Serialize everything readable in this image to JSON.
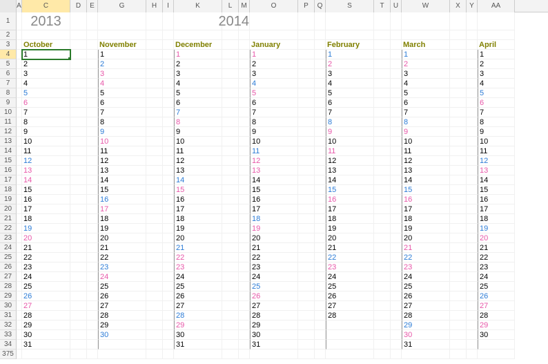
{
  "colHeaders": [
    {
      "label": "A",
      "w": 8,
      "active": false
    },
    {
      "label": "C",
      "w": 70,
      "active": true
    },
    {
      "label": "D",
      "w": 24,
      "active": false
    },
    {
      "label": "E",
      "w": 16,
      "active": false
    },
    {
      "label": "G",
      "w": 70,
      "active": false
    },
    {
      "label": "H",
      "w": 24,
      "active": false
    },
    {
      "label": "I",
      "w": 16,
      "active": false
    },
    {
      "label": "K",
      "w": 70,
      "active": false
    },
    {
      "label": "L",
      "w": 24,
      "active": false
    },
    {
      "label": "M",
      "w": 16,
      "active": false
    },
    {
      "label": "O",
      "w": 70,
      "active": false
    },
    {
      "label": "P",
      "w": 24,
      "active": false
    },
    {
      "label": "Q",
      "w": 16,
      "active": false
    },
    {
      "label": "S",
      "w": 70,
      "active": false
    },
    {
      "label": "T",
      "w": 24,
      "active": false
    },
    {
      "label": "U",
      "w": 16,
      "active": false
    },
    {
      "label": "W",
      "w": 70,
      "active": false
    },
    {
      "label": "X",
      "w": 24,
      "active": false
    },
    {
      "label": "Y",
      "w": 16,
      "active": false
    },
    {
      "label": "AA",
      "w": 54,
      "active": false
    }
  ],
  "rowHeaders": [
    "1",
    "2",
    "3",
    "4",
    "5",
    "6",
    "7",
    "8",
    "9",
    "10",
    "11",
    "12",
    "13",
    "14",
    "15",
    "16",
    "17",
    "18",
    "19",
    "20",
    "21",
    "22",
    "23",
    "24",
    "25",
    "26",
    "27",
    "28",
    "29",
    "30",
    "31",
    "32",
    "33",
    "34",
    "375"
  ],
  "yearLeft": "2013",
  "yearRight": "2014",
  "selectedRow": 4,
  "months": [
    {
      "name": "October",
      "border": false,
      "days": [
        {
          "n": "1",
          "c": "black"
        },
        {
          "n": "2",
          "c": "black"
        },
        {
          "n": "3",
          "c": "black"
        },
        {
          "n": "4",
          "c": "black"
        },
        {
          "n": "5",
          "c": "blue"
        },
        {
          "n": "6",
          "c": "pink"
        },
        {
          "n": "7",
          "c": "black"
        },
        {
          "n": "8",
          "c": "black"
        },
        {
          "n": "9",
          "c": "black"
        },
        {
          "n": "10",
          "c": "black"
        },
        {
          "n": "11",
          "c": "black"
        },
        {
          "n": "12",
          "c": "blue"
        },
        {
          "n": "13",
          "c": "pink"
        },
        {
          "n": "14",
          "c": "pink"
        },
        {
          "n": "15",
          "c": "black"
        },
        {
          "n": "16",
          "c": "black"
        },
        {
          "n": "17",
          "c": "black"
        },
        {
          "n": "18",
          "c": "black"
        },
        {
          "n": "19",
          "c": "blue"
        },
        {
          "n": "20",
          "c": "pink"
        },
        {
          "n": "21",
          "c": "black"
        },
        {
          "n": "22",
          "c": "black"
        },
        {
          "n": "23",
          "c": "black"
        },
        {
          "n": "24",
          "c": "black"
        },
        {
          "n": "25",
          "c": "black"
        },
        {
          "n": "26",
          "c": "blue"
        },
        {
          "n": "27",
          "c": "pink"
        },
        {
          "n": "28",
          "c": "black"
        },
        {
          "n": "29",
          "c": "black"
        },
        {
          "n": "30",
          "c": "black"
        },
        {
          "n": "31",
          "c": "black"
        }
      ]
    },
    {
      "name": "November",
      "border": true,
      "days": [
        {
          "n": "1",
          "c": "black"
        },
        {
          "n": "2",
          "c": "blue"
        },
        {
          "n": "3",
          "c": "pink"
        },
        {
          "n": "4",
          "c": "pink"
        },
        {
          "n": "5",
          "c": "black"
        },
        {
          "n": "6",
          "c": "black"
        },
        {
          "n": "7",
          "c": "black"
        },
        {
          "n": "8",
          "c": "black"
        },
        {
          "n": "9",
          "c": "blue"
        },
        {
          "n": "10",
          "c": "pink"
        },
        {
          "n": "11",
          "c": "black"
        },
        {
          "n": "12",
          "c": "black"
        },
        {
          "n": "13",
          "c": "black"
        },
        {
          "n": "14",
          "c": "black"
        },
        {
          "n": "15",
          "c": "black"
        },
        {
          "n": "16",
          "c": "blue"
        },
        {
          "n": "17",
          "c": "pink"
        },
        {
          "n": "18",
          "c": "black"
        },
        {
          "n": "19",
          "c": "black"
        },
        {
          "n": "20",
          "c": "black"
        },
        {
          "n": "21",
          "c": "black"
        },
        {
          "n": "22",
          "c": "black"
        },
        {
          "n": "23",
          "c": "blue"
        },
        {
          "n": "24",
          "c": "pink"
        },
        {
          "n": "25",
          "c": "black"
        },
        {
          "n": "26",
          "c": "black"
        },
        {
          "n": "27",
          "c": "black"
        },
        {
          "n": "28",
          "c": "black"
        },
        {
          "n": "29",
          "c": "black"
        },
        {
          "n": "30",
          "c": "blue"
        }
      ]
    },
    {
      "name": "December",
      "border": true,
      "days": [
        {
          "n": "1",
          "c": "pink"
        },
        {
          "n": "2",
          "c": "black"
        },
        {
          "n": "3",
          "c": "black"
        },
        {
          "n": "4",
          "c": "black"
        },
        {
          "n": "5",
          "c": "black"
        },
        {
          "n": "6",
          "c": "black"
        },
        {
          "n": "7",
          "c": "blue"
        },
        {
          "n": "8",
          "c": "pink"
        },
        {
          "n": "9",
          "c": "black"
        },
        {
          "n": "10",
          "c": "black"
        },
        {
          "n": "11",
          "c": "black"
        },
        {
          "n": "12",
          "c": "black"
        },
        {
          "n": "13",
          "c": "black"
        },
        {
          "n": "14",
          "c": "blue"
        },
        {
          "n": "15",
          "c": "pink"
        },
        {
          "n": "16",
          "c": "black"
        },
        {
          "n": "17",
          "c": "black"
        },
        {
          "n": "18",
          "c": "black"
        },
        {
          "n": "19",
          "c": "black"
        },
        {
          "n": "20",
          "c": "black"
        },
        {
          "n": "21",
          "c": "blue"
        },
        {
          "n": "22",
          "c": "pink"
        },
        {
          "n": "23",
          "c": "pink"
        },
        {
          "n": "24",
          "c": "black"
        },
        {
          "n": "25",
          "c": "black"
        },
        {
          "n": "26",
          "c": "black"
        },
        {
          "n": "27",
          "c": "black"
        },
        {
          "n": "28",
          "c": "blue"
        },
        {
          "n": "29",
          "c": "pink"
        },
        {
          "n": "30",
          "c": "black"
        },
        {
          "n": "31",
          "c": "black"
        }
      ]
    },
    {
      "name": "January",
      "border": true,
      "days": [
        {
          "n": "1",
          "c": "pink"
        },
        {
          "n": "2",
          "c": "black"
        },
        {
          "n": "3",
          "c": "black"
        },
        {
          "n": "4",
          "c": "blue"
        },
        {
          "n": "5",
          "c": "pink"
        },
        {
          "n": "6",
          "c": "black"
        },
        {
          "n": "7",
          "c": "black"
        },
        {
          "n": "8",
          "c": "black"
        },
        {
          "n": "9",
          "c": "black"
        },
        {
          "n": "10",
          "c": "black"
        },
        {
          "n": "11",
          "c": "blue"
        },
        {
          "n": "12",
          "c": "pink"
        },
        {
          "n": "13",
          "c": "pink"
        },
        {
          "n": "14",
          "c": "black"
        },
        {
          "n": "15",
          "c": "black"
        },
        {
          "n": "16",
          "c": "black"
        },
        {
          "n": "17",
          "c": "black"
        },
        {
          "n": "18",
          "c": "blue"
        },
        {
          "n": "19",
          "c": "pink"
        },
        {
          "n": "20",
          "c": "black"
        },
        {
          "n": "21",
          "c": "black"
        },
        {
          "n": "22",
          "c": "black"
        },
        {
          "n": "23",
          "c": "black"
        },
        {
          "n": "24",
          "c": "black"
        },
        {
          "n": "25",
          "c": "blue"
        },
        {
          "n": "26",
          "c": "pink"
        },
        {
          "n": "27",
          "c": "black"
        },
        {
          "n": "28",
          "c": "black"
        },
        {
          "n": "29",
          "c": "black"
        },
        {
          "n": "30",
          "c": "black"
        },
        {
          "n": "31",
          "c": "black"
        }
      ]
    },
    {
      "name": "February",
      "border": true,
      "days": [
        {
          "n": "1",
          "c": "blue"
        },
        {
          "n": "2",
          "c": "pink"
        },
        {
          "n": "3",
          "c": "black"
        },
        {
          "n": "4",
          "c": "black"
        },
        {
          "n": "5",
          "c": "black"
        },
        {
          "n": "6",
          "c": "black"
        },
        {
          "n": "7",
          "c": "black"
        },
        {
          "n": "8",
          "c": "blue"
        },
        {
          "n": "9",
          "c": "pink"
        },
        {
          "n": "10",
          "c": "black"
        },
        {
          "n": "11",
          "c": "pink"
        },
        {
          "n": "12",
          "c": "black"
        },
        {
          "n": "13",
          "c": "black"
        },
        {
          "n": "14",
          "c": "black"
        },
        {
          "n": "15",
          "c": "blue"
        },
        {
          "n": "16",
          "c": "pink"
        },
        {
          "n": "17",
          "c": "black"
        },
        {
          "n": "18",
          "c": "black"
        },
        {
          "n": "19",
          "c": "black"
        },
        {
          "n": "20",
          "c": "black"
        },
        {
          "n": "21",
          "c": "black"
        },
        {
          "n": "22",
          "c": "blue"
        },
        {
          "n": "23",
          "c": "pink"
        },
        {
          "n": "24",
          "c": "black"
        },
        {
          "n": "25",
          "c": "black"
        },
        {
          "n": "26",
          "c": "black"
        },
        {
          "n": "27",
          "c": "black"
        },
        {
          "n": "28",
          "c": "black"
        }
      ]
    },
    {
      "name": "March",
      "border": true,
      "days": [
        {
          "n": "1",
          "c": "blue"
        },
        {
          "n": "2",
          "c": "pink"
        },
        {
          "n": "3",
          "c": "black"
        },
        {
          "n": "4",
          "c": "black"
        },
        {
          "n": "5",
          "c": "black"
        },
        {
          "n": "6",
          "c": "black"
        },
        {
          "n": "7",
          "c": "black"
        },
        {
          "n": "8",
          "c": "blue"
        },
        {
          "n": "9",
          "c": "pink"
        },
        {
          "n": "10",
          "c": "black"
        },
        {
          "n": "11",
          "c": "black"
        },
        {
          "n": "12",
          "c": "black"
        },
        {
          "n": "13",
          "c": "black"
        },
        {
          "n": "14",
          "c": "black"
        },
        {
          "n": "15",
          "c": "blue"
        },
        {
          "n": "16",
          "c": "pink"
        },
        {
          "n": "17",
          "c": "black"
        },
        {
          "n": "18",
          "c": "black"
        },
        {
          "n": "19",
          "c": "black"
        },
        {
          "n": "20",
          "c": "black"
        },
        {
          "n": "21",
          "c": "pink"
        },
        {
          "n": "22",
          "c": "blue"
        },
        {
          "n": "23",
          "c": "pink"
        },
        {
          "n": "24",
          "c": "black"
        },
        {
          "n": "25",
          "c": "black"
        },
        {
          "n": "26",
          "c": "black"
        },
        {
          "n": "27",
          "c": "black"
        },
        {
          "n": "28",
          "c": "black"
        },
        {
          "n": "29",
          "c": "blue"
        },
        {
          "n": "30",
          "c": "pink"
        },
        {
          "n": "31",
          "c": "black"
        }
      ]
    },
    {
      "name": "April",
      "border": true,
      "days": [
        {
          "n": "1",
          "c": "black"
        },
        {
          "n": "2",
          "c": "black"
        },
        {
          "n": "3",
          "c": "black"
        },
        {
          "n": "4",
          "c": "black"
        },
        {
          "n": "5",
          "c": "blue"
        },
        {
          "n": "6",
          "c": "pink"
        },
        {
          "n": "7",
          "c": "black"
        },
        {
          "n": "8",
          "c": "black"
        },
        {
          "n": "9",
          "c": "black"
        },
        {
          "n": "10",
          "c": "black"
        },
        {
          "n": "11",
          "c": "black"
        },
        {
          "n": "12",
          "c": "blue"
        },
        {
          "n": "13",
          "c": "pink"
        },
        {
          "n": "14",
          "c": "black"
        },
        {
          "n": "15",
          "c": "black"
        },
        {
          "n": "16",
          "c": "black"
        },
        {
          "n": "17",
          "c": "black"
        },
        {
          "n": "18",
          "c": "black"
        },
        {
          "n": "19",
          "c": "blue"
        },
        {
          "n": "20",
          "c": "pink"
        },
        {
          "n": "21",
          "c": "black"
        },
        {
          "n": "22",
          "c": "black"
        },
        {
          "n": "23",
          "c": "black"
        },
        {
          "n": "24",
          "c": "black"
        },
        {
          "n": "25",
          "c": "black"
        },
        {
          "n": "26",
          "c": "blue"
        },
        {
          "n": "27",
          "c": "pink"
        },
        {
          "n": "28",
          "c": "black"
        },
        {
          "n": "29",
          "c": "pink"
        },
        {
          "n": "30",
          "c": "black"
        }
      ]
    }
  ]
}
